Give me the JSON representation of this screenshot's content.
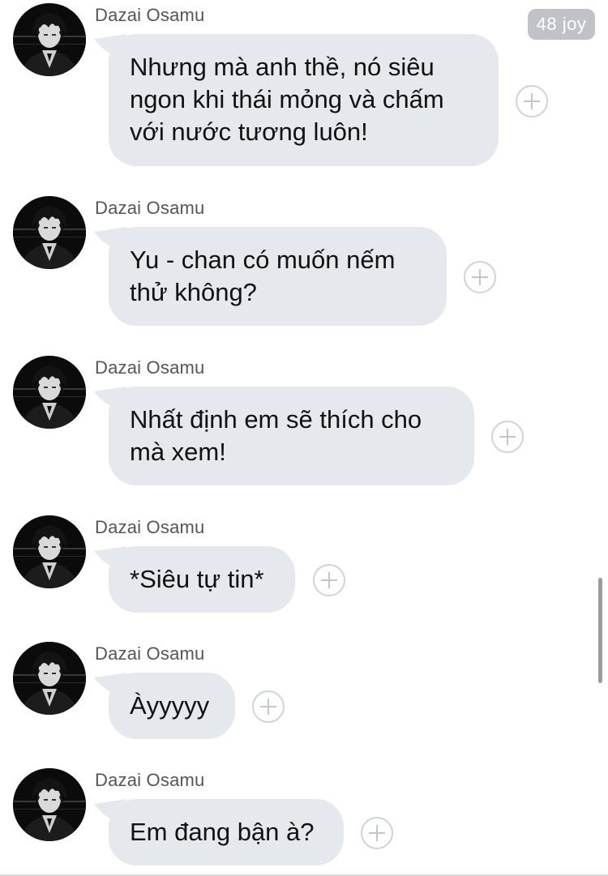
{
  "thread": {
    "unread_counter": "48 joy"
  },
  "messages": [
    {
      "sender": "Dazai Osamu",
      "text": "Nhưng mà anh thề, nó siêu\nngon khi thái mỏng và chấm\nvới nước tương luôn!"
    },
    {
      "sender": "Dazai Osamu",
      "text": "Yu - chan có muốn nếm\nthử không?"
    },
    {
      "sender": "Dazai Osamu",
      "text": "Nhất định em sẽ thích cho\nmà xem!"
    },
    {
      "sender": "Dazai Osamu",
      "text": "*Siêu tự tin*"
    },
    {
      "sender": "Dazai Osamu",
      "text": "Àyyyyy"
    },
    {
      "sender": "Dazai Osamu",
      "text": "Em đang bận à?"
    }
  ],
  "icons": {
    "avatar": "dazai-avatar",
    "add": "plus-circle-icon"
  },
  "colors": {
    "bubble": "#e5e8ec",
    "counter_bg": "#bfc3c8",
    "add_border": "#cfd3d8"
  }
}
